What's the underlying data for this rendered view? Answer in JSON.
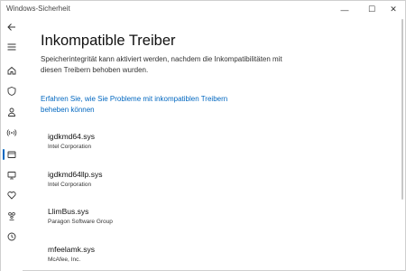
{
  "window": {
    "title": "Windows-Sicherheit",
    "minimize_glyph": "—",
    "maximize_glyph": "☐",
    "close_glyph": "✕"
  },
  "nav": {
    "items": [
      {
        "icon": "back-arrow-icon"
      },
      {
        "icon": "hamburger-menu-icon"
      },
      {
        "icon": "home-icon"
      },
      {
        "icon": "shield-icon"
      },
      {
        "icon": "person-icon"
      },
      {
        "icon": "wireless-icon"
      },
      {
        "icon": "app-browser-control-icon",
        "active": true
      },
      {
        "icon": "device-security-icon"
      },
      {
        "icon": "heart-icon"
      },
      {
        "icon": "family-icon"
      },
      {
        "icon": "history-icon"
      }
    ],
    "accent": "#0067c0"
  },
  "main": {
    "title": "Inkompatible Treiber",
    "description": "Speicherintegrität kann aktiviert werden, nachdem die Inkompatibilitäten mit diesen Treibern behoben wurden.",
    "link": "Erfahren Sie, wie Sie Probleme mit inkompatiblen Treibern beheben können",
    "drivers": [
      {
        "name": "igdkmd64.sys",
        "vendor": "Intel Corporation"
      },
      {
        "name": "igdkmd64llp.sys",
        "vendor": "Intel Corporation"
      },
      {
        "name": "LlimBus.sys",
        "vendor": "Paragon Software Group"
      },
      {
        "name": "mfeelamk.sys",
        "vendor": "McAfee, Inc."
      }
    ]
  }
}
